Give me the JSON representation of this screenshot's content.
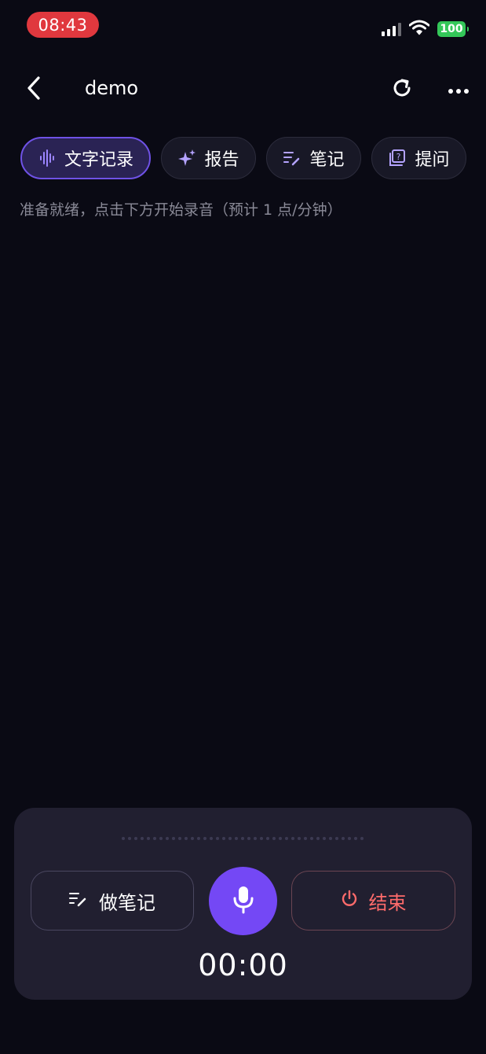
{
  "status_bar": {
    "time": "08:43",
    "battery": "100",
    "battery_color": "#34c759",
    "time_pill_color": "#e0383e"
  },
  "nav": {
    "title": "demo",
    "back_icon": "chevron-left-icon",
    "refresh_icon": "refresh-icon",
    "more_icon": "more-horizontal-icon"
  },
  "tabs": [
    {
      "label": "文字记录",
      "icon": "waveform-icon",
      "active": true
    },
    {
      "label": "报告",
      "icon": "sparkle-icon",
      "active": false
    },
    {
      "label": "笔记",
      "icon": "note-pen-icon",
      "active": false
    },
    {
      "label": "提问",
      "icon": "question-doc-icon",
      "active": false
    }
  ],
  "hint": "准备就绪，点击下方开始录音（预计 1 点/分钟）",
  "panel": {
    "note_button": "做笔记",
    "end_button": "结束",
    "timer": "00:00",
    "accent_color": "#7448f5",
    "end_color": "#ff6b6b"
  }
}
